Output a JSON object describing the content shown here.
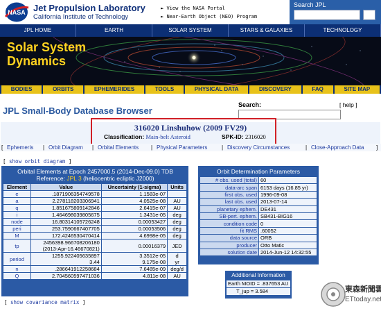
{
  "header": {
    "org_title": "Jet Propulsion Laboratory",
    "org_subtitle": "California Institute of Technology",
    "quick_links": [
      "View the NASA Portal",
      "Near-Earth Object (NEO) Program"
    ],
    "search_label": "Search JPL",
    "search_value": "",
    "logo_text": "NASA"
  },
  "top_nav": [
    "JPL HOME",
    "EARTH",
    "SOLAR SYSTEM",
    "STARS & GALAXIES",
    "TECHNOLOGY"
  ],
  "banner": {
    "line1": "Solar System",
    "line2": "Dynamics"
  },
  "yellow_nav": [
    "BODIES",
    "ORBITS",
    "EPHEMERIDES",
    "TOOLS",
    "PHYSICAL DATA",
    "DISCOVERY",
    "FAQ",
    "SITE MAP"
  ],
  "sbdb": {
    "page_title": "JPL Small-Body Database Browser",
    "search_label": "Search:",
    "search_value": "",
    "help": "[ help ]"
  },
  "object": {
    "name": "316020 Linshuhow (2009 FV29)",
    "classification_label": "Classification:",
    "classification_value": "Main-belt Asteroid",
    "spk_label": "SPK-ID:",
    "spk_value": "2316020"
  },
  "tabs": [
    "Ephemeris",
    "Orbit Diagram",
    "Orbital Elements",
    "Physical Parameters",
    "Discovery Circumstances",
    "Close-Approach Data"
  ],
  "orbit_diagram_link": {
    "prefix": "[ ",
    "label": "show orbit diagram",
    "suffix": " ]"
  },
  "orbital_elements": {
    "title_line1": "Orbital Elements at Epoch 2457000.5 (2014-Dec-09.0) TDB",
    "title_line2_prefix": "Reference: ",
    "title_line2_ref": "JPL 3",
    "title_line2_suffix": " (heliocentric ecliptic J2000)",
    "columns": [
      "Element",
      "Value",
      "Uncertainty (1-sigma)",
      "Units"
    ],
    "rows": [
      {
        "element": "e",
        "value": ".1871906354749578",
        "unc": "1.1583e-07",
        "units": ""
      },
      {
        "element": "a",
        "value": "2.278118203306941",
        "unc": "4.0525e-08",
        "units": "AU"
      },
      {
        "element": "q",
        "value": "1.851675809142846",
        "unc": "2.6415e-07",
        "units": "AU"
      },
      {
        "element": "i",
        "value": "1.464698039805675",
        "unc": "1.3431e-05",
        "units": "deg"
      },
      {
        "element": "node",
        "value": "16.80314105726248",
        "unc": "0.00053427",
        "units": "deg"
      },
      {
        "element": "peri",
        "value": "253.7590667407705",
        "unc": "0.00053506",
        "units": "deg"
      },
      {
        "element": "M",
        "value": "172.4246530470414",
        "unc": "4.6998e-05",
        "units": "deg"
      },
      {
        "element": "tp",
        "value": "2456398.966708206180",
        "value2": "(2013-Apr-16.46670821)",
        "unc": "0.00016379",
        "units": "JED"
      },
      {
        "element": "period",
        "value": "1255.922405635897",
        "value2": "3.44",
        "unc": "3.3512e-05",
        "unc2": "9.175e-08",
        "units": "d",
        "units2": "yr"
      },
      {
        "element": "n",
        "value": ".286641912258684",
        "unc": "7.6485e-09",
        "units": "deg/d"
      },
      {
        "element": "Q",
        "value": "2.704560597471036",
        "unc": "4.811e-08",
        "units": "AU"
      }
    ]
  },
  "orbit_determination": {
    "title": "Orbit Determination Parameters",
    "rows": [
      {
        "k": "# obs. used (total)",
        "v": "60"
      },
      {
        "k": "data-arc span",
        "v": "6153 days (16.85 yr)"
      },
      {
        "k": "first obs. used",
        "v": "1996-09-08"
      },
      {
        "k": "last obs. used",
        "v": "2013-07-14"
      },
      {
        "k": "planetary ephem.",
        "v": "DE431"
      },
      {
        "k": "SB-pert. ephem.",
        "v": "SB431-BIG16"
      },
      {
        "k": "condition code",
        "v": "0"
      },
      {
        "k": "fit RMS",
        "v": ".60052"
      },
      {
        "k": "data source",
        "v": "ORB"
      },
      {
        "k": "producer",
        "v": "Otto Matic"
      },
      {
        "k": "solution date",
        "v": "2014-Jun-12 14:32:55"
      }
    ]
  },
  "additional_info": {
    "title": "Additional Information",
    "moid": "Earth MOID = .837653 AU",
    "tj": "T_jup = 3.584"
  },
  "covariance_link": {
    "prefix": "[ ",
    "label": "show covariance matrix",
    "suffix": " ]"
  },
  "watermark": {
    "line1": "東森新聞雲",
    "line2": "ETtoday.net"
  }
}
